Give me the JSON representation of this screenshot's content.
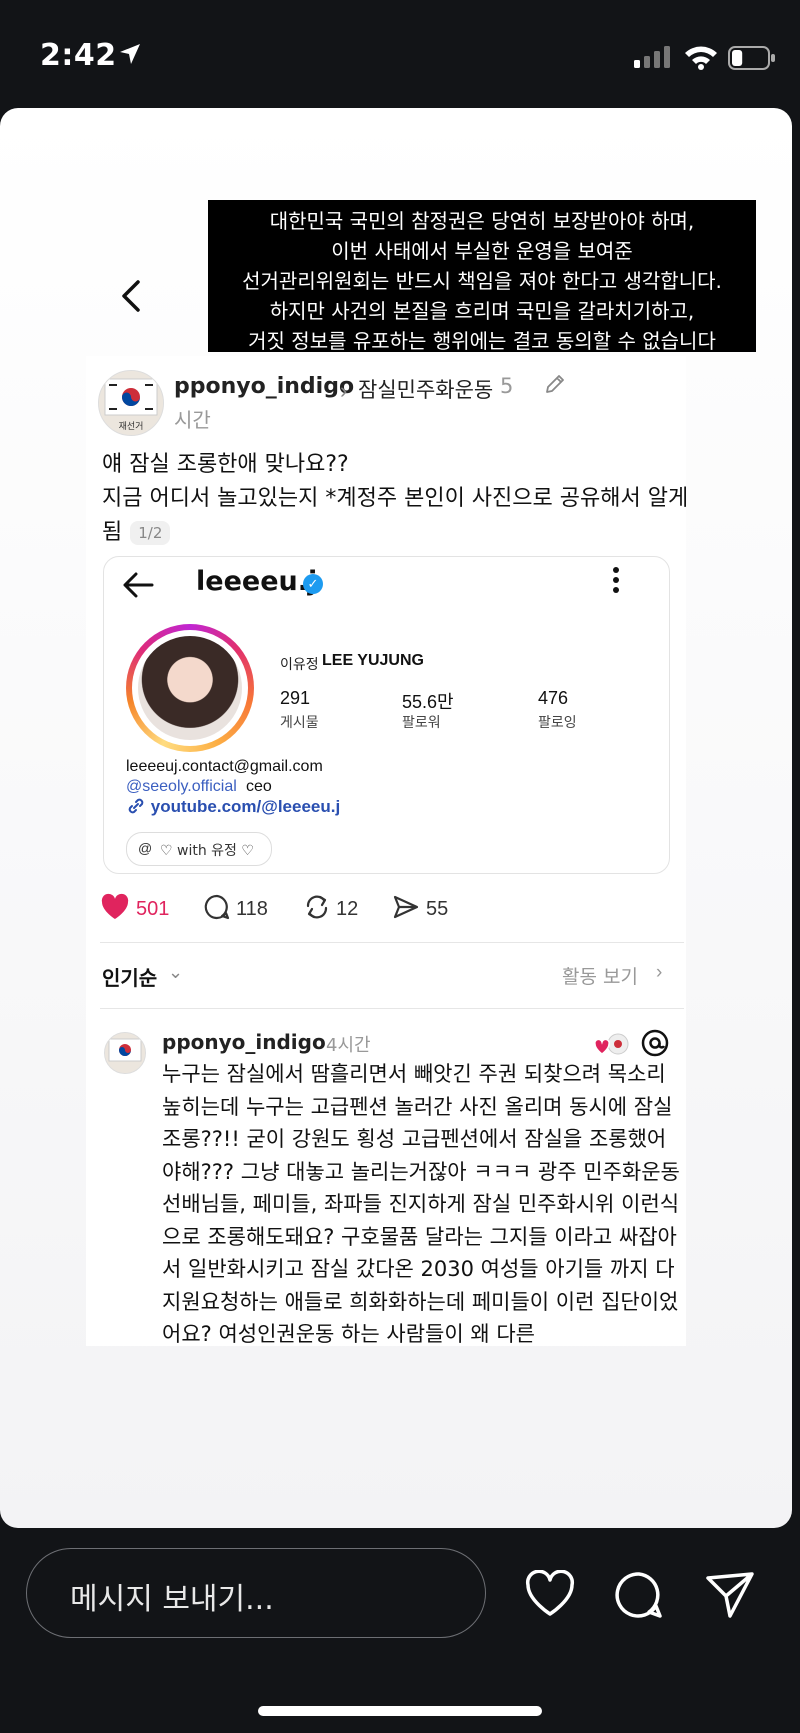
{
  "status_bar": {
    "time": "2:42",
    "battery_level": 0.3
  },
  "caption_lines": [
    "대한민국 국민의 참정권은 당연히 보장받아야 하며,",
    "이번 사태에서 부실한 운영을 보여준",
    "선거관리위원회는 반드시 책임을 져야 한다고 생각합니다.",
    "하지만 사건의 본질을 흐리며 국민을 갈라치기하고,",
    "거짓 정보를 유포하는 행위에는 결코 동의할 수 없습니다"
  ],
  "post": {
    "username": "pponyo_indigo",
    "chevron": "›",
    "community": "잠실민주화운동",
    "hours_num": "5",
    "hours_unit": "시간",
    "avatar_text": "재선거",
    "body_line1": "얘 잠실 조롱한애 맞나요??",
    "body_line2": "지금 어디서 놀고있는지 *계정주 본인이 사진으로 공유해서 알게",
    "body_line3": "됨",
    "pager": "1/2"
  },
  "embed": {
    "username": "leeeeu.j",
    "verified": "✓",
    "more": "⋮",
    "name_kr": "이유정",
    "name_en": "LEE YUJUNG",
    "stats": [
      {
        "value": "291",
        "label": "게시물"
      },
      {
        "value": "55.6만",
        "label": "팔로워"
      },
      {
        "value": "476",
        "label": "팔로잉"
      }
    ],
    "email": "leeeeuj.contact@gmail.com",
    "mention": "@seeoly.official",
    "ceo": "ceo",
    "link": "youtube.com/@leeeeu.j",
    "threads_chip": "♡ with 유정 ♡",
    "threads_chip_icon": "@"
  },
  "actions": {
    "likes": "501",
    "comments": "118",
    "reposts": "12",
    "shares": "55"
  },
  "sort_label": "인기순",
  "sort_chevron": "⌄",
  "activity_label": "활동 보기",
  "activity_chevron": "›",
  "reply": {
    "username": "pponyo_indigo",
    "time": "4시간",
    "body": "누구는 잠실에서 땀흘리면서 빼앗긴 주권 되찾으려 목소리 높히는데 누구는 고급펜션 놀러간 사진 올리며 동시에 잠실 조롱??!! 굳이 강원도 횡성 고급펜션에서 잠실을 조롱했어야해??? 그냥 대놓고 놀리는거잖아 ㅋㅋㅋ 광주 민주화운동 선배님들, 페미들, 좌파들 진지하게 잠실 민주화시위 이런식으로 조롱해도돼요? 구호물품 달라는 그지들 이라고 싸잡아서 일반화시키고 잠실 갔다온 2030 여성들 아기들 까지 다 지원요청하는 애들로 희화화하는데 페미들이 이런 집단이었어요? 여성인권운동 하는 사람들이 왜 다른"
  },
  "message_bar": {
    "placeholder": "메시지 보내기..."
  },
  "colors": {
    "like": "#e0245e",
    "link": "#2a4fb0",
    "verified": "#1d9bf0",
    "caption_bg": "#000000"
  }
}
